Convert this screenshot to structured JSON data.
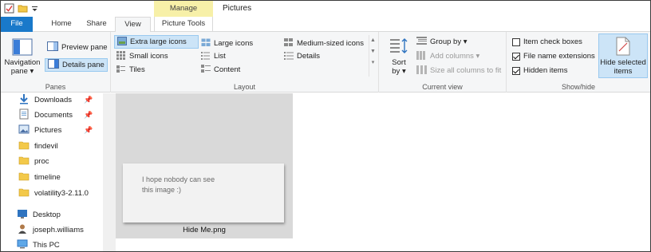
{
  "window": {
    "title": "Pictures",
    "context_tab": "Manage"
  },
  "tabs": {
    "file": "File",
    "home": "Home",
    "share": "Share",
    "view": "View",
    "picture_tools": "Picture Tools"
  },
  "ribbon": {
    "panes": {
      "label": "Panes",
      "navigation_pane": "Navigation",
      "navigation_pane_2": "pane ▾",
      "preview_pane": "Preview pane",
      "details_pane": "Details pane"
    },
    "layout": {
      "label": "Layout",
      "extra_large_icons": "Extra large icons",
      "large_icons": "Large icons",
      "medium_icons": "Medium-sized icons",
      "small_icons": "Small icons",
      "list": "List",
      "details": "Details",
      "tiles": "Tiles",
      "content": "Content"
    },
    "current_view": {
      "label": "Current view",
      "sort_by": "Sort",
      "sort_by_2": "by ▾",
      "group_by": "Group by ▾",
      "add_columns": "Add columns ▾",
      "size_columns": "Size all columns to fit"
    },
    "show_hide": {
      "label": "Show/hide",
      "item_check_boxes": "Item check boxes",
      "item_check_boxes_checked": false,
      "file_name_extensions": "File name extensions",
      "file_name_extensions_checked": true,
      "hidden_items": "Hidden items",
      "hidden_items_checked": true,
      "hide_selected": "Hide selected",
      "hide_selected_2": "items"
    }
  },
  "nav": {
    "items": [
      {
        "label": "Downloads",
        "icon": "download-arrow-icon",
        "pinned": true
      },
      {
        "label": "Documents",
        "icon": "documents-icon",
        "pinned": true
      },
      {
        "label": "Pictures",
        "icon": "pictures-icon",
        "pinned": true
      },
      {
        "label": "findevil",
        "icon": "folder-icon",
        "pinned": false
      },
      {
        "label": "proc",
        "icon": "folder-icon",
        "pinned": false
      },
      {
        "label": "timeline",
        "icon": "folder-icon",
        "pinned": false
      },
      {
        "label": "volatility3-2.11.0",
        "icon": "folder-icon",
        "pinned": false
      },
      {
        "label": "Desktop",
        "icon": "desktop-icon",
        "pinned": false
      },
      {
        "label": "joseph.williams",
        "icon": "user-icon",
        "pinned": false
      },
      {
        "label": "This PC",
        "icon": "this-pc-icon",
        "pinned": false
      }
    ]
  },
  "content": {
    "file": {
      "name": "Hide Me.png",
      "preview_line1": "I hope nobody can see",
      "preview_line2": "this image :)"
    }
  },
  "colors": {
    "file_tab": "#1979ca",
    "manage_context": "#f7f0a8",
    "selection": "#cce4f7",
    "folder": "#f3c94a"
  }
}
